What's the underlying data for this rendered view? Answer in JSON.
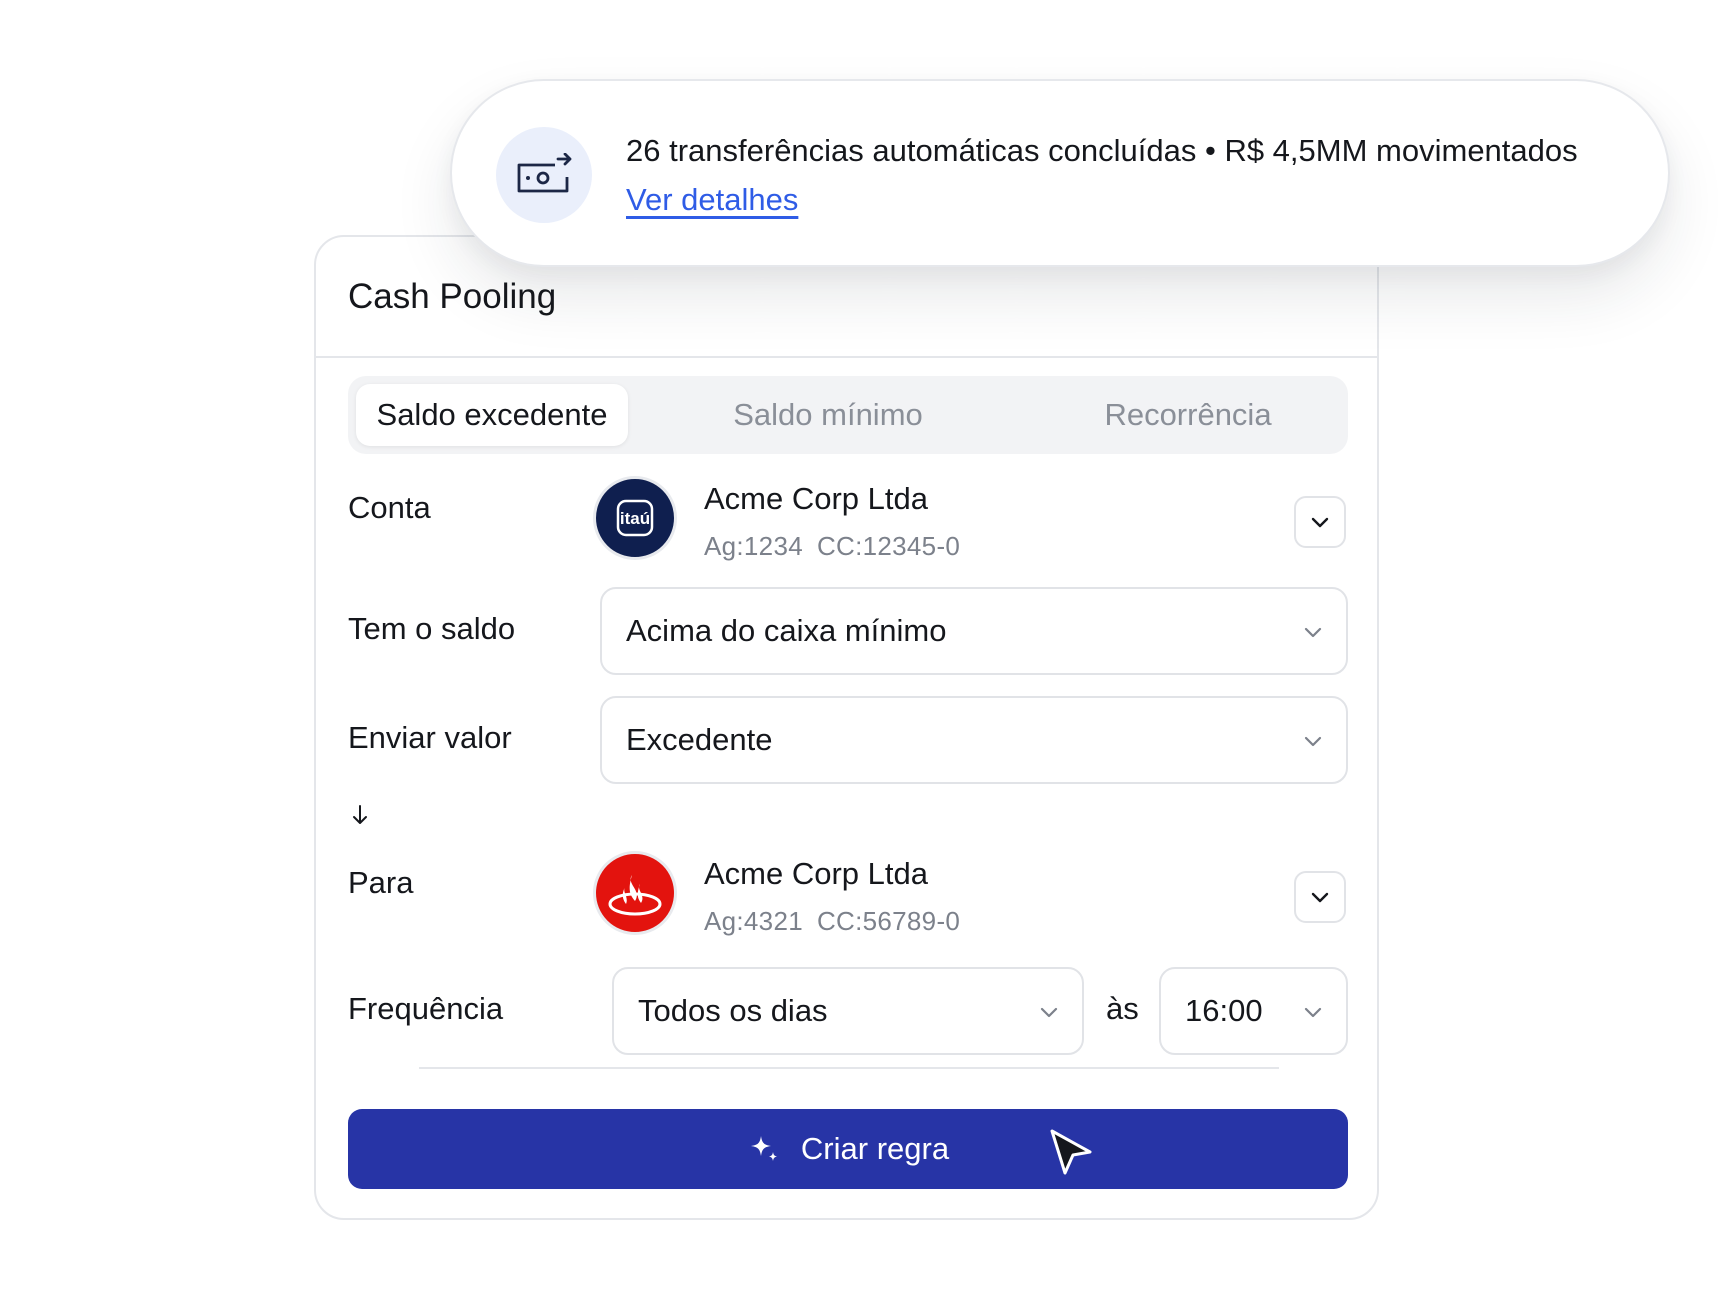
{
  "notification": {
    "icon": "money-transfer-icon",
    "message": "26 transferências automáticas concluídas • R$ 4,5MM movimentados",
    "link_label": "Ver detalhes"
  },
  "card": {
    "title": "Cash Pooling",
    "tabs": [
      {
        "label": "Saldo excedente",
        "active": true
      },
      {
        "label": "Saldo mínimo",
        "active": false
      },
      {
        "label": "Recorrência",
        "active": false
      }
    ]
  },
  "form": {
    "conta": {
      "label": "Conta",
      "bank_logo": "itau-logo",
      "bank_logo_text": "itaú",
      "name": "Acme Corp Ltda",
      "agency": "Ag:1234",
      "account": "CC:12345-0"
    },
    "saldo": {
      "label": "Tem o saldo",
      "value": "Acima do caixa mínimo"
    },
    "enviar": {
      "label": "Enviar valor",
      "value": "Excedente"
    },
    "para": {
      "label": "Para",
      "bank_logo": "santander-logo",
      "name": "Acme Corp Ltda",
      "agency": "Ag:4321",
      "account": "CC:56789-0"
    },
    "frequencia": {
      "label": "Frequência",
      "value": "Todos os dias",
      "at_label": "às",
      "time": "16:00"
    }
  },
  "cta": {
    "label": "Criar regra",
    "icon": "sparkle-icon"
  },
  "colors": {
    "primary": "#2734a6",
    "link": "#2f5ce6",
    "itau_navy": "#0f1f4f",
    "santander_red": "#e3130e"
  }
}
